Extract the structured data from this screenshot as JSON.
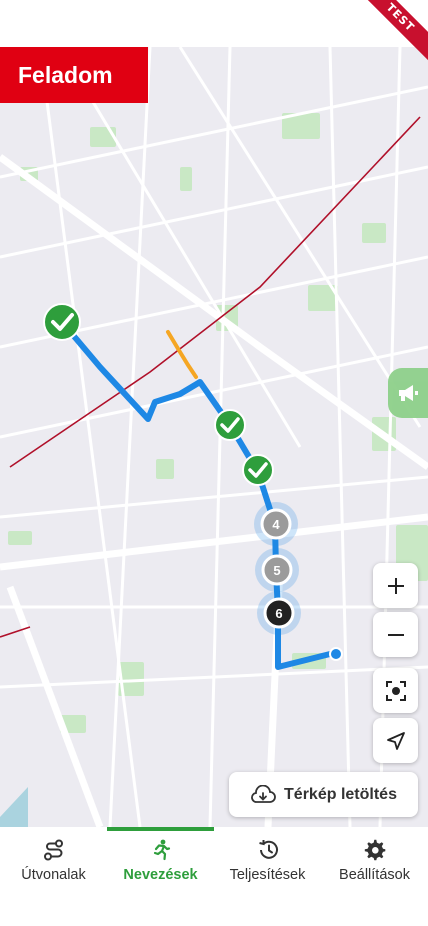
{
  "header": {
    "give_up_label": "Feladom",
    "test_ribbon": "TEST"
  },
  "map": {
    "controls": {
      "zoom_in_icon": "plus-icon",
      "zoom_out_icon": "minus-icon",
      "recenter_icon": "recenter-icon",
      "locate_icon": "navigation-arrow-icon",
      "announce_icon": "megaphone-icon"
    },
    "checkpoints": [
      {
        "status": "done"
      },
      {
        "status": "done"
      },
      {
        "status": "done"
      },
      {
        "status": "upcoming",
        "label": "4"
      },
      {
        "status": "upcoming",
        "label": "5"
      },
      {
        "status": "current",
        "label": "6"
      }
    ],
    "download_label": "Térkép letöltés",
    "download_icon": "cloud-download-icon"
  },
  "nav": {
    "tabs": [
      {
        "label": "Útvonalak",
        "icon": "route-icon"
      },
      {
        "label": "Nevezések",
        "icon": "runner-icon",
        "active": true
      },
      {
        "label": "Teljesítések",
        "icon": "history-icon"
      },
      {
        "label": "Beállítások",
        "icon": "gear-icon"
      }
    ]
  },
  "colors": {
    "accent": "#2e9e3c",
    "route": "#1e88e5",
    "danger": "#e00012",
    "orange": "#f5a623"
  }
}
